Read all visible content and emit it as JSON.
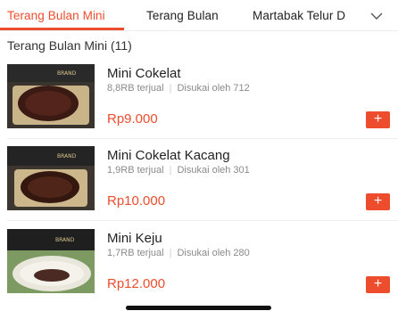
{
  "tabs": [
    {
      "label": "Terang Bulan Mini",
      "active": true
    },
    {
      "label": "Terang Bulan",
      "active": false
    },
    {
      "label": "Martabak Telur D",
      "active": false
    }
  ],
  "more_icon": "chevron-down-icon",
  "section": {
    "title": "Terang Bulan Mini (11)"
  },
  "items": [
    {
      "name": "Mini Cokelat",
      "sold": "8,8RB terjual",
      "likes": "Disukai oleh 712",
      "price": "Rp9.000",
      "add_label": "+"
    },
    {
      "name": "Mini Cokelat Kacang",
      "sold": "1,9RB terjual",
      "likes": "Disukai oleh 301",
      "price": "Rp10.000",
      "add_label": "+"
    },
    {
      "name": "Mini Keju",
      "sold": "1,7RB terjual",
      "likes": "Disukai oleh 280",
      "price": "Rp12.000",
      "add_label": "+"
    }
  ],
  "colors": {
    "accent": "#ee4d2d",
    "muted": "#8a8a8a"
  }
}
